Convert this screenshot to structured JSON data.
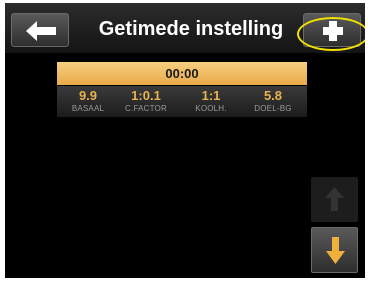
{
  "header": {
    "title": "Getimede instelling",
    "back_icon": "arrow-left-icon",
    "add_icon": "plus-icon"
  },
  "setting": {
    "time": "00:00",
    "fields": [
      {
        "value": "9.9",
        "label": "BASAAL"
      },
      {
        "value": "1:0.1",
        "label": "C.FACTOR"
      },
      {
        "value": "1:1",
        "label": "KOOLH."
      },
      {
        "value": "5.8",
        "label": "DOEL-BG"
      }
    ]
  },
  "scroll": {
    "up_icon": "arrow-up-icon",
    "down_icon": "arrow-down-icon"
  },
  "colors": {
    "accent": "#e8b24f",
    "time_bar": "#f0bd62",
    "highlight": "#f2e000",
    "background": "#000000"
  }
}
